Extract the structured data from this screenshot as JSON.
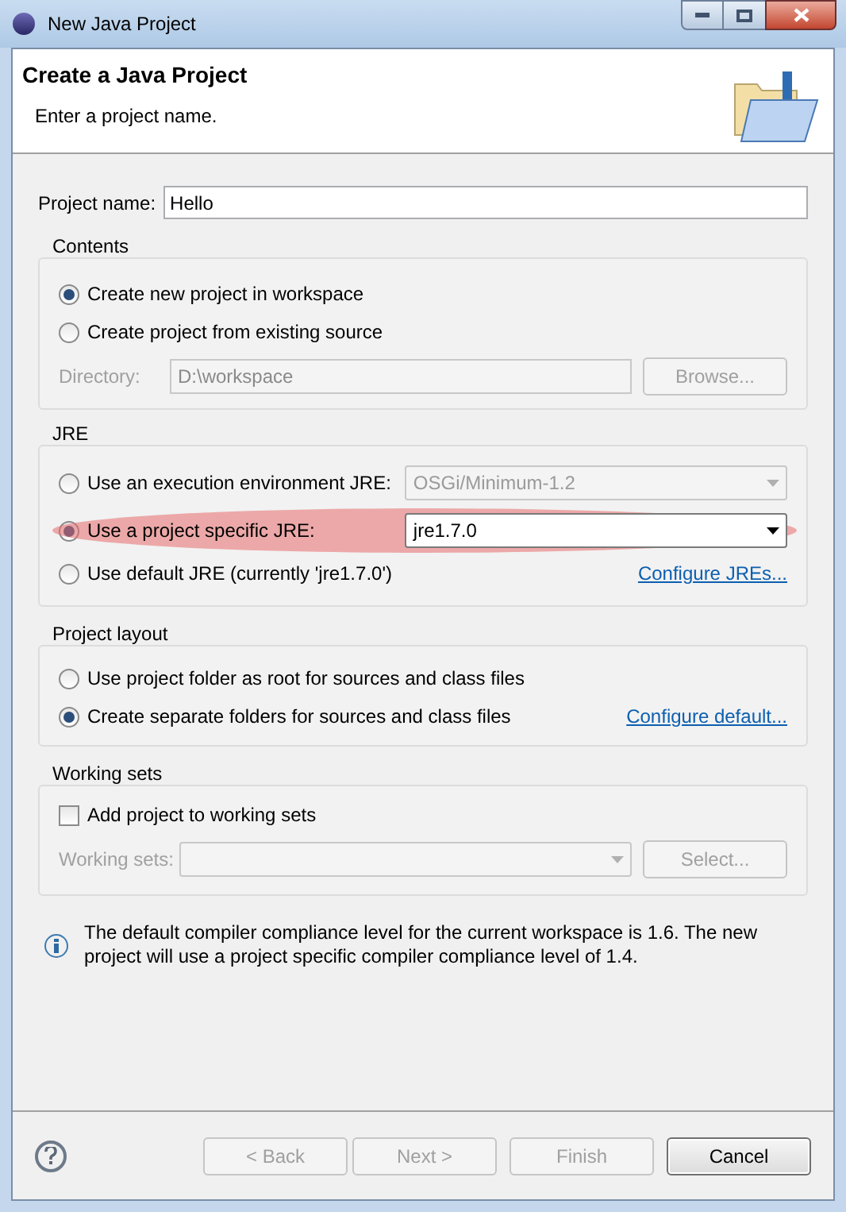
{
  "window": {
    "title": "New Java Project"
  },
  "header": {
    "title": "Create a Java Project",
    "subtitle": "Enter a project name."
  },
  "project_name": {
    "label": "Project name:",
    "value": "Hello"
  },
  "contents": {
    "title": "Contents",
    "options": [
      {
        "label": "Create new project in workspace",
        "selected": true
      },
      {
        "label": "Create project from existing source",
        "selected": false
      }
    ],
    "directory": {
      "label": "Directory:",
      "value": "D:\\workspace",
      "disabled": true
    },
    "browse": {
      "label": "Browse...",
      "disabled": true
    }
  },
  "jre": {
    "title": "JRE",
    "options": [
      {
        "kind": "combo",
        "label": "Use an execution environment JRE:",
        "selected": false,
        "highlighted": false,
        "combo": {
          "value": "OSGi/Minimum-1.2",
          "disabled": true
        }
      },
      {
        "kind": "combo",
        "label": "Use a project specific JRE:",
        "selected": true,
        "highlighted": true,
        "combo": {
          "value": "jre1.7.0",
          "disabled": false
        }
      },
      {
        "kind": "link",
        "label": "Use default JRE (currently 'jre1.7.0')",
        "selected": false,
        "highlighted": false,
        "link": "Configure JREs..."
      }
    ]
  },
  "layout": {
    "title": "Project layout",
    "options": [
      {
        "kind": "plain",
        "label": "Use project folder as root for sources and class files",
        "selected": false
      },
      {
        "kind": "link",
        "label": "Create separate folders for sources and class files",
        "selected": true,
        "link": "Configure default..."
      }
    ]
  },
  "working_sets": {
    "title": "Working sets",
    "checkbox": {
      "label": "Add project to working sets",
      "checked": false
    },
    "field": {
      "label": "Working sets:",
      "disabled": true
    },
    "select": {
      "label": "Select...",
      "disabled": true
    }
  },
  "info": "The default compiler compliance level for the current workspace is 1.6. The new project will use a project specific compiler compliance level of 1.4.",
  "buttons": [
    {
      "label": "< Back",
      "disabled": true
    },
    {
      "label": "Next >",
      "disabled": true
    },
    {
      "label": "Finish",
      "disabled": true
    },
    {
      "label": "Cancel",
      "disabled": false
    }
  ]
}
